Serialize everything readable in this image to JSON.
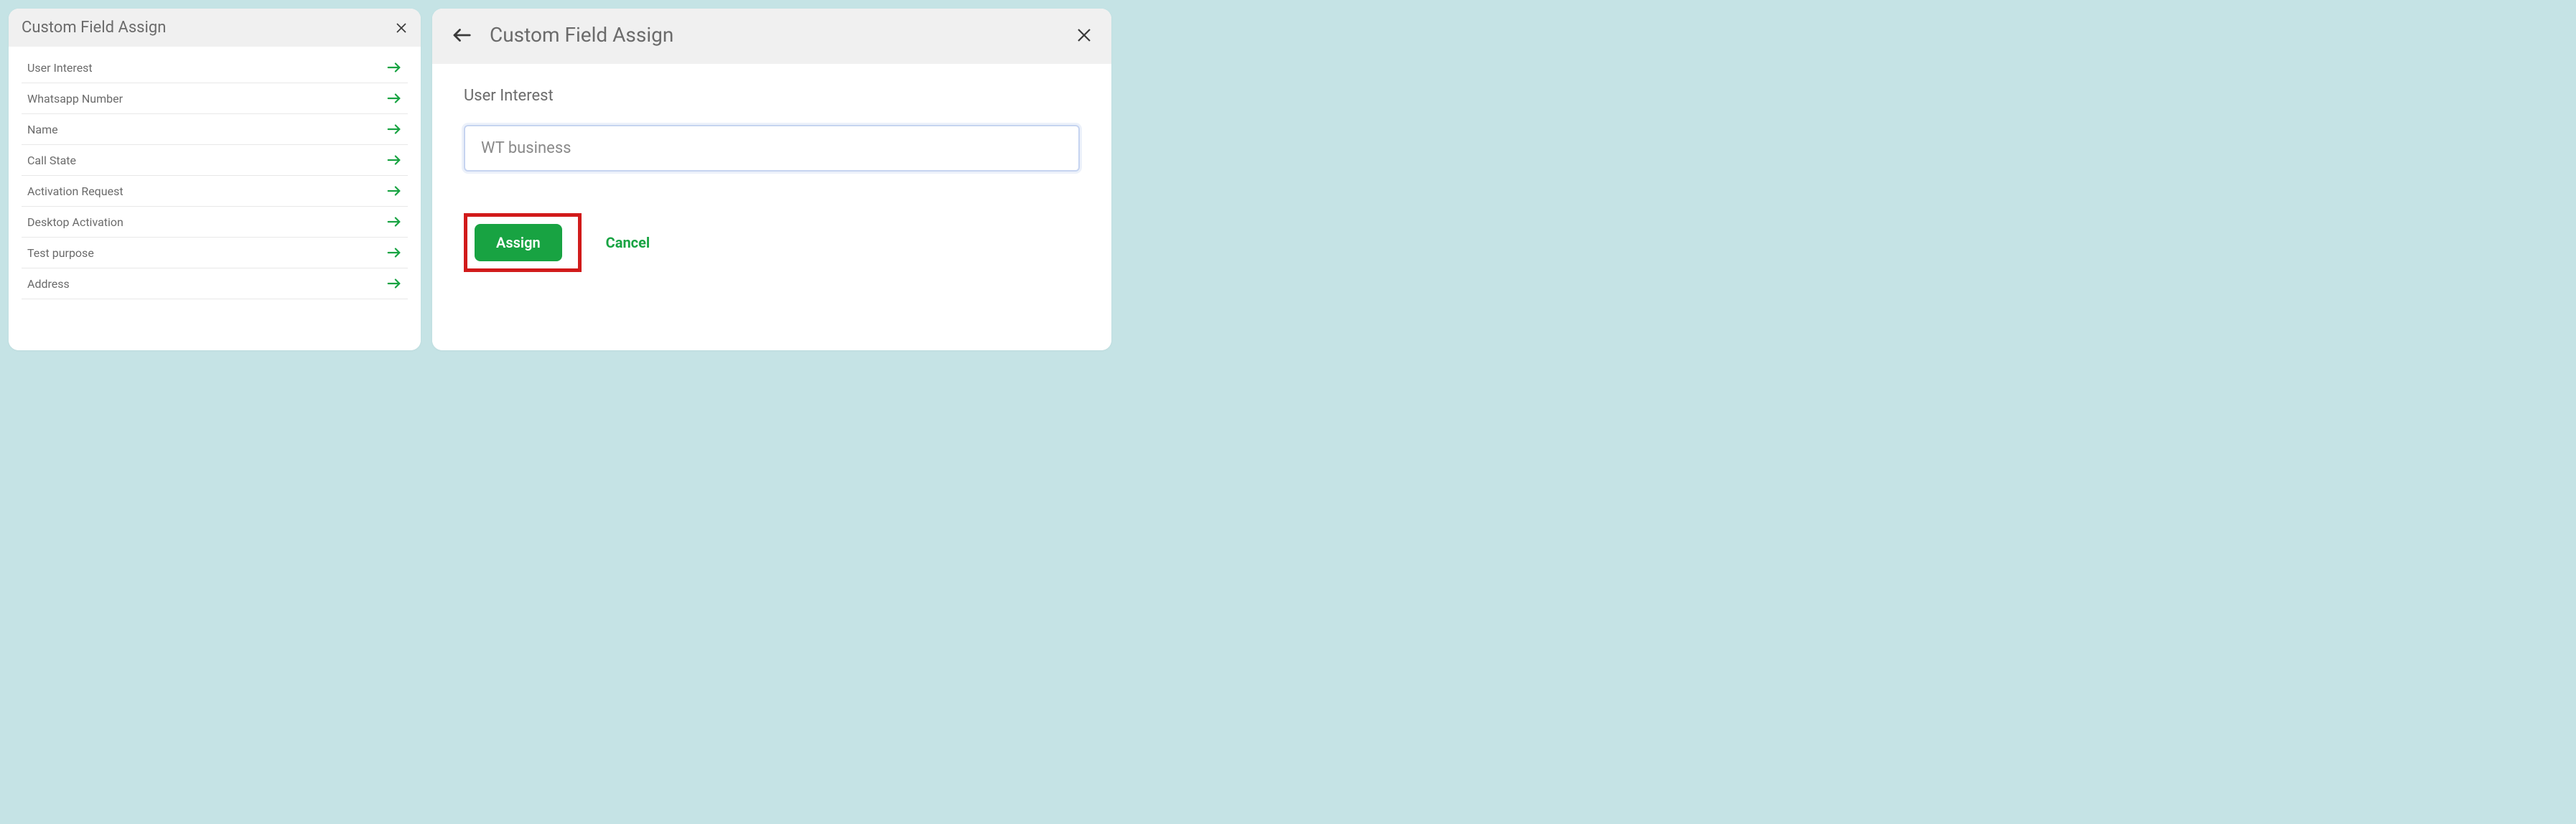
{
  "left_panel": {
    "title": "Custom Field Assign",
    "fields": [
      {
        "label": "User Interest"
      },
      {
        "label": "Whatsapp Number"
      },
      {
        "label": "Name"
      },
      {
        "label": "Call State"
      },
      {
        "label": "Activation Request"
      },
      {
        "label": "Desktop Activation"
      },
      {
        "label": "Test purpose"
      },
      {
        "label": "Address"
      }
    ]
  },
  "right_panel": {
    "title": "Custom Field Assign",
    "field_label": "User Interest",
    "input_value": "WT business",
    "assign_label": "Assign",
    "cancel_label": "Cancel"
  },
  "colors": {
    "accent_green": "#18a342",
    "highlight_red": "#d11a1a",
    "input_border": "#c6d4f0",
    "text_muted": "#6b6b6b",
    "page_bg": "#c5e3e5"
  }
}
